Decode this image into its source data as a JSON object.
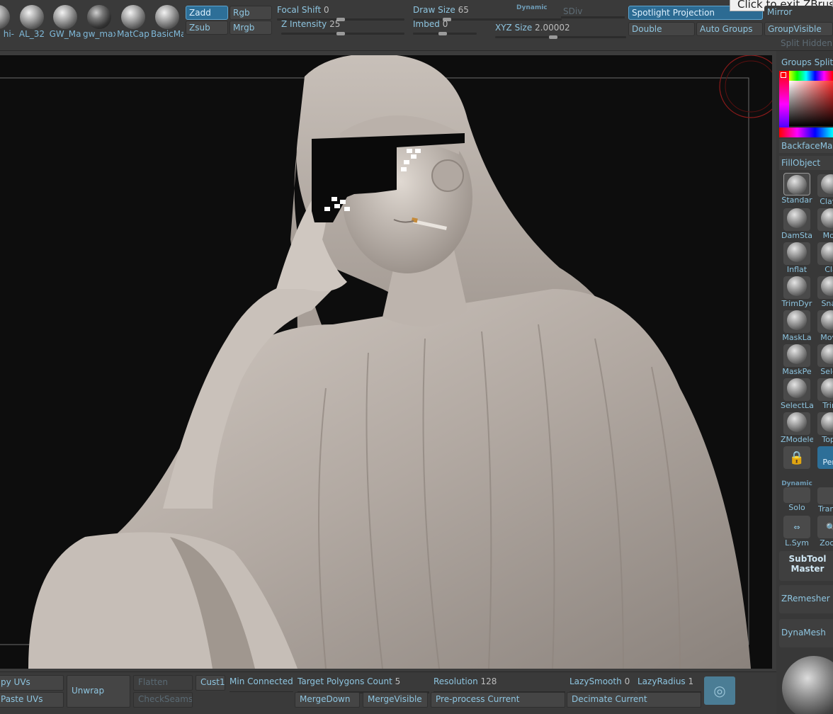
{
  "tooltip": "Click to exit ZBrush",
  "materials": [
    "hi-",
    "AL_32",
    "GW_Ma",
    "gw_max",
    "MatCap",
    "BasicMa"
  ],
  "draw": {
    "zadd": "Zadd",
    "zsub": "Zsub",
    "rgb": "Rgb",
    "mrgb": "Mrgb",
    "focal_shift_label": "Focal Shift",
    "focal_shift_value": "0",
    "z_intensity_label": "Z Intensity",
    "z_intensity_value": "25",
    "draw_size_label": "Draw Size",
    "draw_size_value": "65",
    "dynamic": "Dynamic",
    "imbed_label": "Imbed",
    "imbed_value": "0",
    "sdiv": "SDiv",
    "xyz_size_label": "XYZ Size",
    "xyz_size_value": "2.00002"
  },
  "right_top": {
    "spotlight": "Spotlight Projection",
    "mirror": "Mirror",
    "double": "Double",
    "auto_groups": "Auto Groups",
    "group_visible": "GroupVisible",
    "split_hidden": "Split Hidden",
    "groups_split": "Groups Split"
  },
  "tray": {
    "backface": "BackfaceMas",
    "fill_object": "FillObject",
    "brushes": [
      [
        "Standar",
        "ClayB"
      ],
      [
        "DamSta",
        "Mov"
      ],
      [
        "Inflat",
        "Cla"
      ],
      [
        "TrimDyr",
        "Snak"
      ],
      [
        "MaskLa",
        "Move"
      ],
      [
        "MaskPe",
        "Selec"
      ],
      [
        "SelectLa",
        "Trim"
      ],
      [
        "ZModele",
        "Topo"
      ]
    ],
    "dynamic": "Dynamic",
    "solo": "Solo",
    "persp": "Pers",
    "transp": "Transp",
    "lsym": "L.Sym",
    "zoom": "Zoom",
    "subtool_master": "SubTool Master",
    "zremesher": "ZRemesher",
    "dynamesh": "DynaMesh"
  },
  "bottom": {
    "copy_uvs": "py UVs",
    "paste_uvs": "Paste UVs",
    "unwrap": "Unwrap",
    "flatten": "Flatten",
    "check_seams": "CheckSeams",
    "cust1": "Cust1",
    "min_connected": "Min Connected I",
    "target_poly_label": "Target Polygons Count",
    "target_poly_value": "5",
    "merge_down": "MergeDown",
    "merge_visible": "MergeVisible",
    "resolution_label": "Resolution",
    "resolution_value": "128",
    "preprocess": "Pre-process Current",
    "lazy_smooth_label": "LazySmooth",
    "lazy_smooth_value": "0",
    "lazy_radius_label": "LazyRadius",
    "lazy_radius_value": "1",
    "decimate": "Decimate Current"
  },
  "colors": {
    "accent": "#8ec5e0",
    "active": "#2d6f98",
    "bg": "#3a3a3a"
  }
}
